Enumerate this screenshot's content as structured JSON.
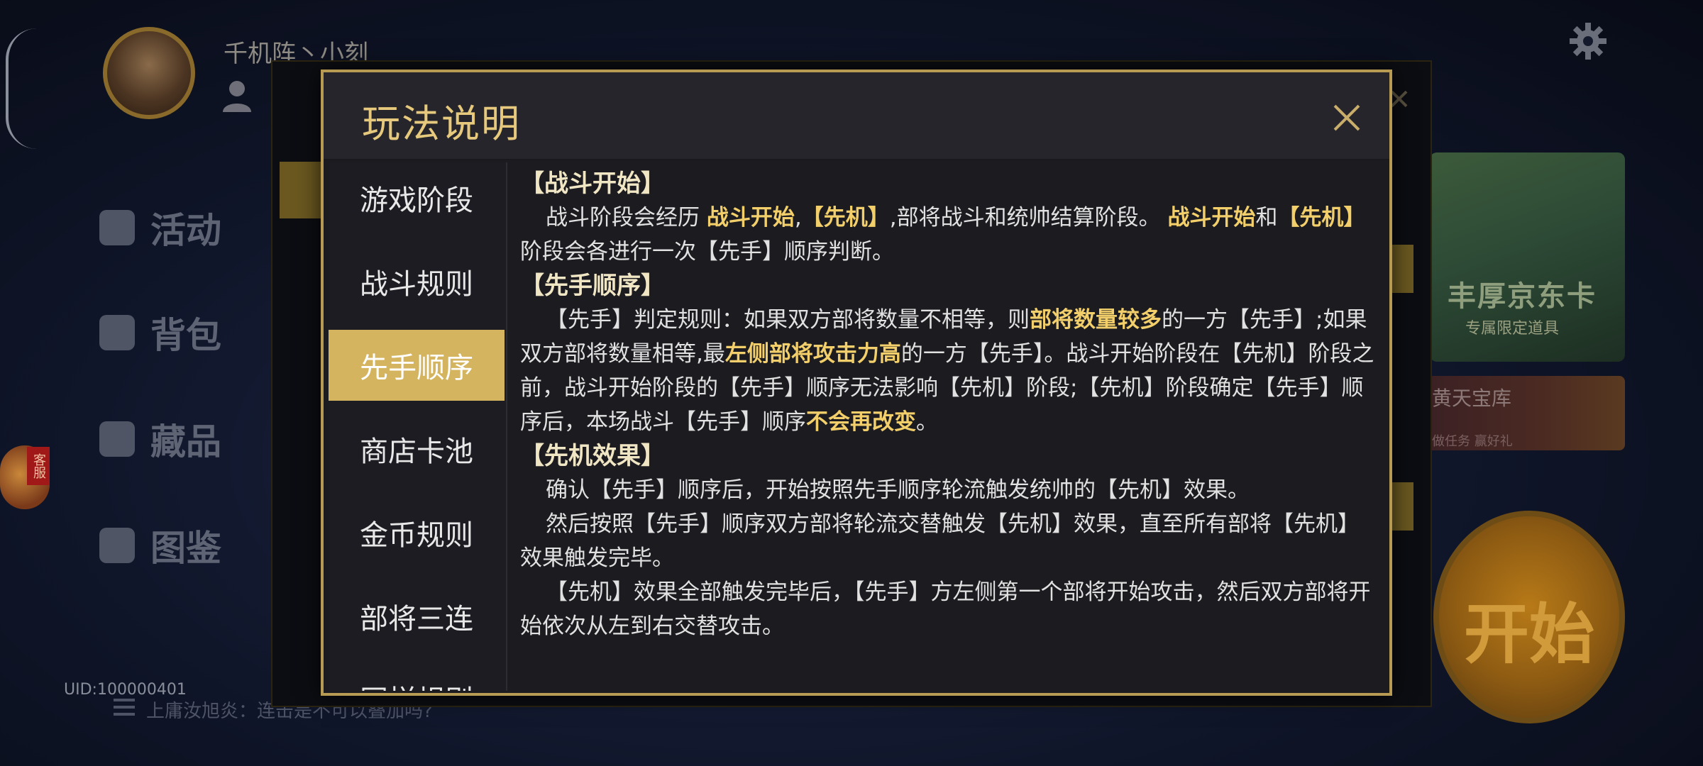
{
  "background": {
    "player_name": "千机阵丶小刻",
    "uid": "UID:100000401",
    "chat": "上庸汝旭炎：连击是不可以叠加吗?",
    "nav": [
      {
        "label": "活动",
        "icon": "flag-icon"
      },
      {
        "label": "背包",
        "icon": "bag-icon"
      },
      {
        "label": "藏品",
        "icon": "chest-icon"
      },
      {
        "label": "图鉴",
        "icon": "book-icon"
      }
    ],
    "support_label": "客服",
    "banner_title": "丰厚京东卡",
    "banner_sub": "专属限定道具",
    "treasure_title": "黄天宝库",
    "treasure_sub": "做任务  赢好礼",
    "start_label": "开始"
  },
  "dialog": {
    "title": "玩法说明",
    "tabs": [
      "游戏阶段",
      "战斗规则",
      "先手顺序",
      "商店卡池",
      "金币规则",
      "部将三连",
      "同样规则"
    ],
    "active_tab": "先手顺序",
    "sections": [
      {
        "heading": "【战斗开始】",
        "paragraphs": [
          [
            {
              "t": "战斗阶段会经历 "
            },
            {
              "t": "战斗开始",
              "hl": true
            },
            {
              "t": ","
            },
            {
              "t": "【先机】",
              "hl": true
            },
            {
              "t": ",部将战斗和统帅结算阶段。 "
            },
            {
              "t": "战斗开始",
              "hl": true
            },
            {
              "t": "和"
            },
            {
              "t": "【先机】",
              "hl": true
            },
            {
              "t": "阶段会各进行一次【先手】顺序判断。"
            }
          ]
        ]
      },
      {
        "heading": "【先手顺序】",
        "paragraphs": [
          [
            {
              "t": "【先手】判定规则：如果双方部将数量不相等，则"
            },
            {
              "t": "部将数量较多",
              "hl": true
            },
            {
              "t": "的一方【先手】;如果双方部将数量相等,最"
            },
            {
              "t": "左侧部将攻击力高",
              "hl": true
            },
            {
              "t": "的一方【先手】。战斗开始阶段在【先机】阶段之前，战斗开始阶段的【先手】顺序无法影响【先机】阶段;【先机】阶段确定【先手】顺序后，本场战斗【先手】顺序"
            },
            {
              "t": "不会再改变",
              "hl": true
            },
            {
              "t": "。"
            }
          ]
        ]
      },
      {
        "heading": "【先机效果】",
        "paragraphs": [
          [
            {
              "t": "确认【先手】顺序后，开始按照先手顺序轮流触发统帅的【先机】效果。"
            }
          ],
          [
            {
              "t": "然后按照【先手】顺序双方部将轮流交替触发【先机】效果，直至所有部将【先机】效果触发完毕。"
            }
          ],
          [
            {
              "t": "【先机】效果全部触发完毕后，【先手】方左侧第一个部将开始攻击，然后双方部将开始依次从左到右交替攻击。"
            }
          ]
        ]
      }
    ]
  }
}
